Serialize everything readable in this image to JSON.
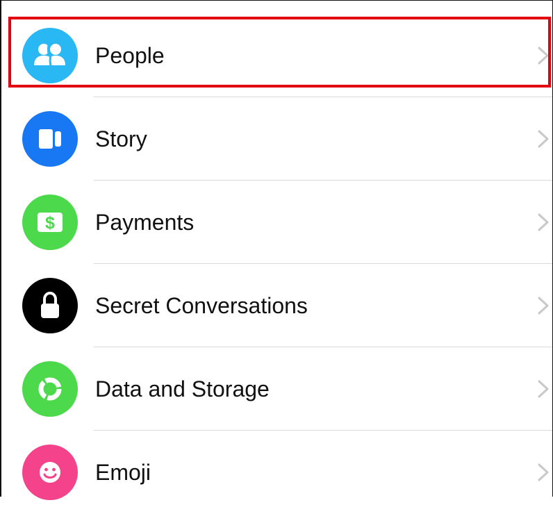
{
  "settings_list": {
    "items": [
      {
        "label": "People",
        "icon": "people-icon",
        "color": "#2ab8f5"
      },
      {
        "label": "Story",
        "icon": "story-icon",
        "color": "#1877f2"
      },
      {
        "label": "Payments",
        "icon": "dollar-icon",
        "color": "#4cd94c"
      },
      {
        "label": "Secret Conversations",
        "icon": "lock-icon",
        "color": "#000000"
      },
      {
        "label": "Data and Storage",
        "icon": "data-storage-icon",
        "color": "#4cd94c"
      },
      {
        "label": "Emoji",
        "icon": "smiley-icon",
        "color": "#f5438b"
      }
    ]
  },
  "highlight": {
    "target": "People",
    "color": "#e3000f"
  }
}
